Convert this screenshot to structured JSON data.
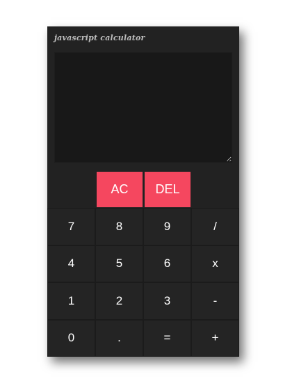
{
  "app": {
    "title": "javascript calculator"
  },
  "display": {
    "value": ""
  },
  "controls": {
    "clear_label": "AC",
    "delete_label": "DEL"
  },
  "keys": [
    {
      "label": "7",
      "name": "key-7"
    },
    {
      "label": "8",
      "name": "key-8"
    },
    {
      "label": "9",
      "name": "key-9"
    },
    {
      "label": "/",
      "name": "key-divide"
    },
    {
      "label": "4",
      "name": "key-4"
    },
    {
      "label": "5",
      "name": "key-5"
    },
    {
      "label": "6",
      "name": "key-6"
    },
    {
      "label": "x",
      "name": "key-multiply"
    },
    {
      "label": "1",
      "name": "key-1"
    },
    {
      "label": "2",
      "name": "key-2"
    },
    {
      "label": "3",
      "name": "key-3"
    },
    {
      "label": "-",
      "name": "key-subtract"
    },
    {
      "label": "0",
      "name": "key-0"
    },
    {
      "label": ".",
      "name": "key-decimal"
    },
    {
      "label": "=",
      "name": "key-equals"
    },
    {
      "label": "+",
      "name": "key-add"
    }
  ],
  "colors": {
    "accent": "#f5475f",
    "panel": "#222222",
    "display": "#181818",
    "key": "#242424"
  }
}
